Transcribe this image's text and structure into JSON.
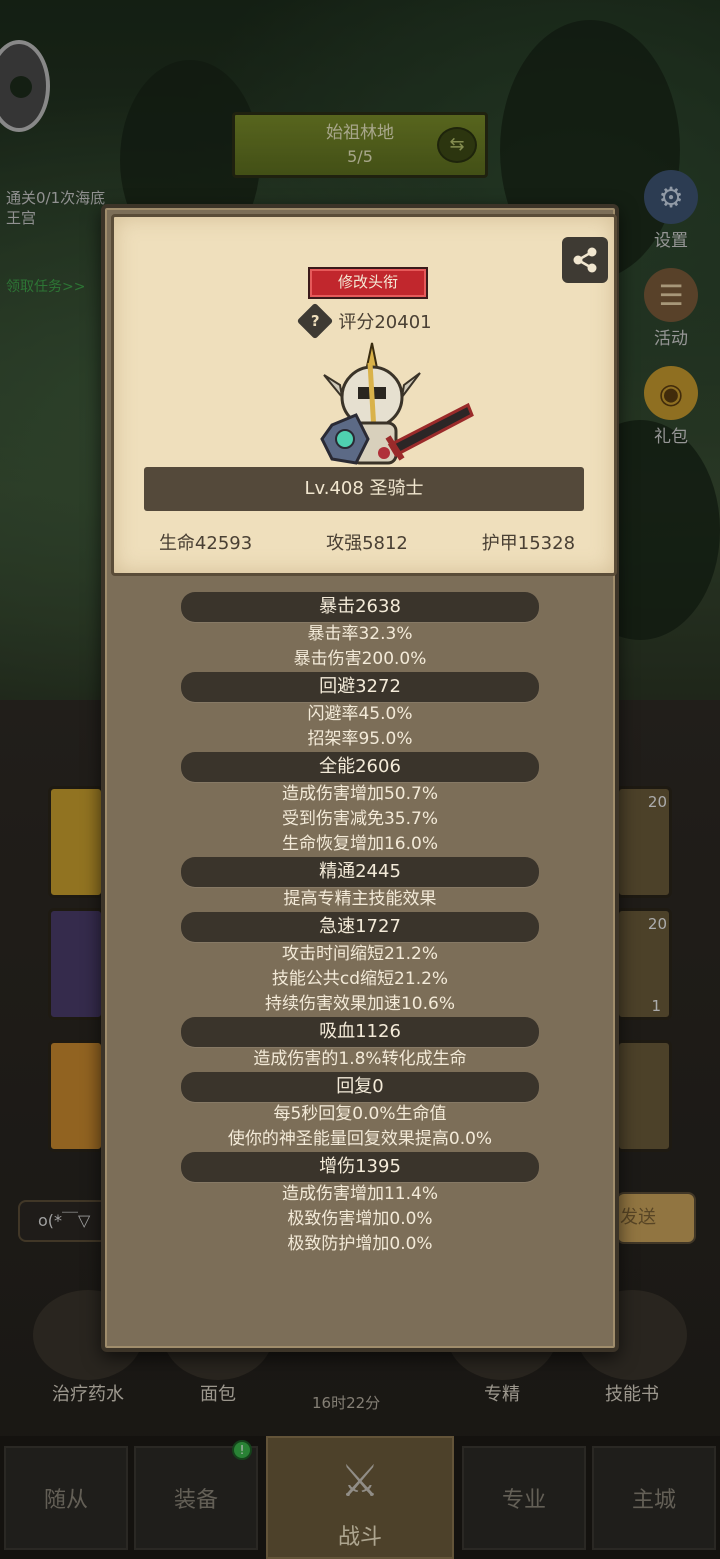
{
  "background": {
    "map_name": "始祖林地",
    "map_progress": "5/5",
    "quest_text": "通关0/1次海底王宫",
    "quest_link": "领取任务>>",
    "side_buttons": [
      "设置",
      "活动",
      "礼包"
    ],
    "chat_placeholder": "o(*￣▽",
    "send_label": "发送",
    "bottom_icons": [
      "治疗药水",
      "面包",
      "专精",
      "技能书"
    ],
    "timer": "16时22分",
    "skill_counts": [
      "20",
      "20",
      "1"
    ],
    "nav_tabs": [
      "随从",
      "装备",
      "战斗",
      "专业",
      "主城"
    ],
    "nav_badge": "!"
  },
  "panel": {
    "title_button": "修改头衔",
    "score": "评分20401",
    "level_class": "Lv.408 圣骑士",
    "stats": [
      "生命42593",
      "攻强5812",
      "护甲15328"
    ],
    "attributes": [
      {
        "head": "暴击2638",
        "lines": [
          "暴击率32.3%",
          "暴击伤害200.0%"
        ]
      },
      {
        "head": "回避3272",
        "lines": [
          "闪避率45.0%",
          "招架率95.0%"
        ]
      },
      {
        "head": "全能2606",
        "lines": [
          "造成伤害增加50.7%",
          "受到伤害减免35.7%",
          "生命恢复增加16.0%"
        ]
      },
      {
        "head": "精通2445",
        "lines": [
          "提高专精主技能效果"
        ]
      },
      {
        "head": "急速1727",
        "lines": [
          "攻击时间缩短21.2%",
          "技能公共cd缩短21.2%",
          "持续伤害效果加速10.6%"
        ]
      },
      {
        "head": "吸血1126",
        "lines": [
          "造成伤害的1.8%转化成生命"
        ]
      },
      {
        "head": "回复0",
        "lines": [
          "每5秒回复0.0%生命值",
          "使你的神圣能量回复效果提高0.0%"
        ]
      },
      {
        "head": "增伤1395",
        "lines": [
          "造成伤害增加11.4%",
          "极致伤害增加0.0%",
          "极致防护增加0.0%"
        ]
      }
    ]
  }
}
